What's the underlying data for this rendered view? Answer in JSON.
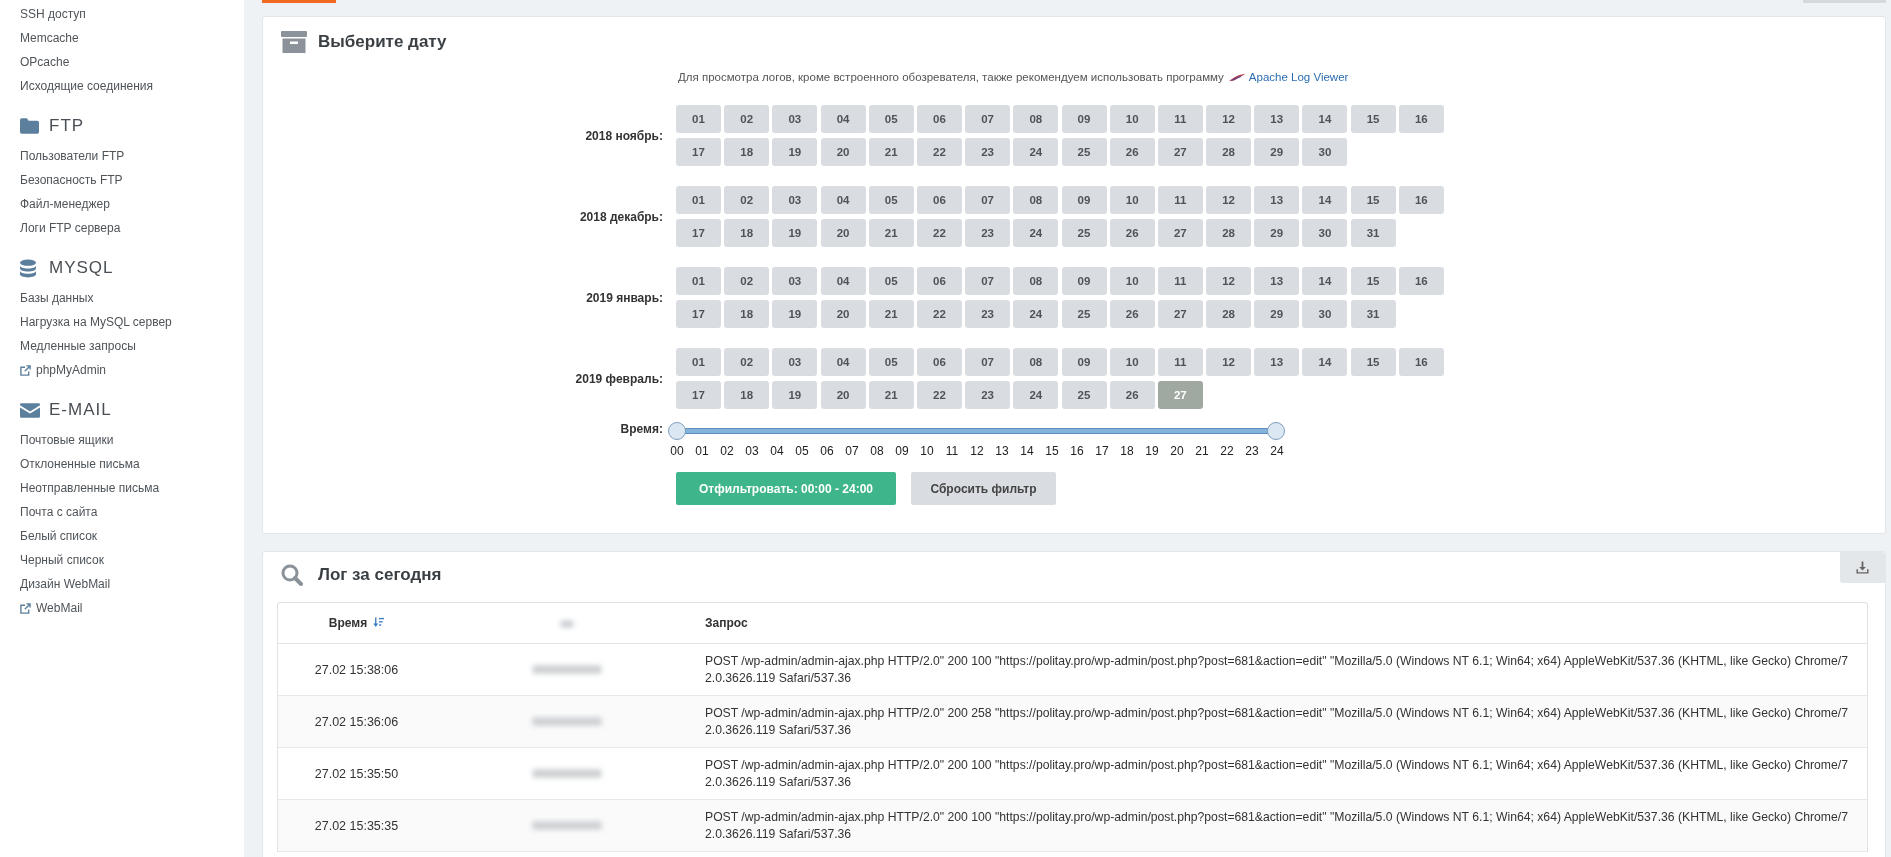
{
  "sidebar": {
    "sections": [
      {
        "items": [
          {
            "label": "SSH доступ",
            "external": false
          },
          {
            "label": "Memcache",
            "external": false
          },
          {
            "label": "OPcache",
            "external": false
          },
          {
            "label": "Исходящие соединения",
            "external": false
          }
        ]
      },
      {
        "title": "FTP",
        "items": [
          {
            "label": "Пользователи FTP",
            "external": false
          },
          {
            "label": "Безопасность FTP",
            "external": false
          },
          {
            "label": "Файл-менеджер",
            "external": false
          },
          {
            "label": "Логи FTP сервера",
            "external": false
          }
        ]
      },
      {
        "title": "MYSQL",
        "items": [
          {
            "label": "Базы данных",
            "external": false
          },
          {
            "label": "Нагрузка на MySQL сервер",
            "external": false
          },
          {
            "label": "Медленные запросы",
            "external": false
          },
          {
            "label": "phpMyAdmin",
            "external": true
          }
        ]
      },
      {
        "title": "E-MAIL",
        "items": [
          {
            "label": "Почтовые ящики",
            "external": false
          },
          {
            "label": "Отклоненные письма",
            "external": false
          },
          {
            "label": "Неотправленные письма",
            "external": false
          },
          {
            "label": "Почта с сайта",
            "external": false
          },
          {
            "label": "Белый список",
            "external": false
          },
          {
            "label": "Черный список",
            "external": false
          },
          {
            "label": "Дизайн WebMail",
            "external": false
          },
          {
            "label": "WebMail",
            "external": true
          }
        ]
      }
    ]
  },
  "date_picker": {
    "title": "Выберите дату",
    "hint": "Для просмотра логов, кроме встроенного обозревателя, также рекомендуем использовать программу",
    "link": "Apache Log Viewer",
    "months": [
      {
        "label": "2018 ноябрь:",
        "days": [
          {
            "label": "01",
            "selected": false
          },
          {
            "label": "02",
            "selected": false
          },
          {
            "label": "03",
            "selected": false
          },
          {
            "label": "04",
            "selected": false
          },
          {
            "label": "05",
            "selected": false
          },
          {
            "label": "06",
            "selected": false
          },
          {
            "label": "07",
            "selected": false
          },
          {
            "label": "08",
            "selected": false
          },
          {
            "label": "09",
            "selected": false
          },
          {
            "label": "10",
            "selected": false
          },
          {
            "label": "11",
            "selected": false
          },
          {
            "label": "12",
            "selected": false
          },
          {
            "label": "13",
            "selected": false
          },
          {
            "label": "14",
            "selected": false
          },
          {
            "label": "15",
            "selected": false
          },
          {
            "label": "16",
            "selected": false
          },
          {
            "label": "17",
            "selected": false
          },
          {
            "label": "18",
            "selected": false
          },
          {
            "label": "19",
            "selected": false
          },
          {
            "label": "20",
            "selected": false
          },
          {
            "label": "21",
            "selected": false
          },
          {
            "label": "22",
            "selected": false
          },
          {
            "label": "23",
            "selected": false
          },
          {
            "label": "24",
            "selected": false
          },
          {
            "label": "25",
            "selected": false
          },
          {
            "label": "26",
            "selected": false
          },
          {
            "label": "27",
            "selected": false
          },
          {
            "label": "28",
            "selected": false
          },
          {
            "label": "29",
            "selected": false
          },
          {
            "label": "30",
            "selected": false
          }
        ]
      },
      {
        "label": "2018 декабрь:",
        "days": [
          {
            "label": "01",
            "selected": false
          },
          {
            "label": "02",
            "selected": false
          },
          {
            "label": "03",
            "selected": false
          },
          {
            "label": "04",
            "selected": false
          },
          {
            "label": "05",
            "selected": false
          },
          {
            "label": "06",
            "selected": false
          },
          {
            "label": "07",
            "selected": false
          },
          {
            "label": "08",
            "selected": false
          },
          {
            "label": "09",
            "selected": false
          },
          {
            "label": "10",
            "selected": false
          },
          {
            "label": "11",
            "selected": false
          },
          {
            "label": "12",
            "selected": false
          },
          {
            "label": "13",
            "selected": false
          },
          {
            "label": "14",
            "selected": false
          },
          {
            "label": "15",
            "selected": false
          },
          {
            "label": "16",
            "selected": false
          },
          {
            "label": "17",
            "selected": false
          },
          {
            "label": "18",
            "selected": false
          },
          {
            "label": "19",
            "selected": false
          },
          {
            "label": "20",
            "selected": false
          },
          {
            "label": "21",
            "selected": false
          },
          {
            "label": "22",
            "selected": false
          },
          {
            "label": "23",
            "selected": false
          },
          {
            "label": "24",
            "selected": false
          },
          {
            "label": "25",
            "selected": false
          },
          {
            "label": "26",
            "selected": false
          },
          {
            "label": "27",
            "selected": false
          },
          {
            "label": "28",
            "selected": false
          },
          {
            "label": "29",
            "selected": false
          },
          {
            "label": "30",
            "selected": false
          },
          {
            "label": "31",
            "selected": false
          }
        ]
      },
      {
        "label": "2019 январь:",
        "days": [
          {
            "label": "01",
            "selected": false
          },
          {
            "label": "02",
            "selected": false
          },
          {
            "label": "03",
            "selected": false
          },
          {
            "label": "04",
            "selected": false
          },
          {
            "label": "05",
            "selected": false
          },
          {
            "label": "06",
            "selected": false
          },
          {
            "label": "07",
            "selected": false
          },
          {
            "label": "08",
            "selected": false
          },
          {
            "label": "09",
            "selected": false
          },
          {
            "label": "10",
            "selected": false
          },
          {
            "label": "11",
            "selected": false
          },
          {
            "label": "12",
            "selected": false
          },
          {
            "label": "13",
            "selected": false
          },
          {
            "label": "14",
            "selected": false
          },
          {
            "label": "15",
            "selected": false
          },
          {
            "label": "16",
            "selected": false
          },
          {
            "label": "17",
            "selected": false
          },
          {
            "label": "18",
            "selected": false
          },
          {
            "label": "19",
            "selected": false
          },
          {
            "label": "20",
            "selected": false
          },
          {
            "label": "21",
            "selected": false
          },
          {
            "label": "22",
            "selected": false
          },
          {
            "label": "23",
            "selected": false
          },
          {
            "label": "24",
            "selected": false
          },
          {
            "label": "25",
            "selected": false
          },
          {
            "label": "26",
            "selected": false
          },
          {
            "label": "27",
            "selected": false
          },
          {
            "label": "28",
            "selected": false
          },
          {
            "label": "29",
            "selected": false
          },
          {
            "label": "30",
            "selected": false
          },
          {
            "label": "31",
            "selected": false
          }
        ]
      },
      {
        "label": "2019 февраль:",
        "days": [
          {
            "label": "01",
            "selected": false
          },
          {
            "label": "02",
            "selected": false
          },
          {
            "label": "03",
            "selected": false
          },
          {
            "label": "04",
            "selected": false
          },
          {
            "label": "05",
            "selected": false
          },
          {
            "label": "06",
            "selected": false
          },
          {
            "label": "07",
            "selected": false
          },
          {
            "label": "08",
            "selected": false
          },
          {
            "label": "09",
            "selected": false
          },
          {
            "label": "10",
            "selected": false
          },
          {
            "label": "11",
            "selected": false
          },
          {
            "label": "12",
            "selected": false
          },
          {
            "label": "13",
            "selected": false
          },
          {
            "label": "14",
            "selected": false
          },
          {
            "label": "15",
            "selected": false
          },
          {
            "label": "16",
            "selected": false
          },
          {
            "label": "17",
            "selected": false
          },
          {
            "label": "18",
            "selected": false
          },
          {
            "label": "19",
            "selected": false
          },
          {
            "label": "20",
            "selected": false
          },
          {
            "label": "21",
            "selected": false
          },
          {
            "label": "22",
            "selected": false
          },
          {
            "label": "23",
            "selected": false
          },
          {
            "label": "24",
            "selected": false
          },
          {
            "label": "25",
            "selected": false
          },
          {
            "label": "26",
            "selected": false
          },
          {
            "label": "27",
            "selected": true
          }
        ]
      }
    ],
    "time": {
      "label": "Время:",
      "handles": [
        {
          "level": 0
        },
        {
          "level": 1
        }
      ],
      "ticks": [
        "00",
        "01",
        "02",
        "03",
        "04",
        "05",
        "06",
        "07",
        "08",
        "09",
        "10",
        "11",
        "12",
        "13",
        "14",
        "15",
        "16",
        "17",
        "18",
        "19",
        "20",
        "21",
        "22",
        "23",
        "24"
      ]
    },
    "buttons": [
      {
        "label": "Отфильтровать: 00:00 - 24:00",
        "kind": "primary"
      },
      {
        "label": "Сбросить фильтр",
        "kind": "secondary"
      }
    ]
  },
  "log": {
    "title": "Лог за сегодня",
    "columns": [
      {
        "kind": "time",
        "label": "Время",
        "sorted": true
      },
      {
        "kind": "blurred",
        "sorted": false
      },
      {
        "kind": "request",
        "label": "Запрос",
        "sorted": false
      }
    ],
    "rows": [
      {
        "time": "27.02 15:38:06",
        "request": "POST /wp-admin/admin-ajax.php HTTP/2.0\" 200 100 \"https://politay.pro/wp-admin/post.php?post=681&action=edit\" \"Mozilla/5.0 (Windows NT 6.1; Win64; x64) AppleWebKit/537.36 (KHTML, like Gecko) Chrome/72.0.3626.119 Safari/537.36"
      },
      {
        "time": "27.02 15:36:06",
        "request": "POST /wp-admin/admin-ajax.php HTTP/2.0\" 200 258 \"https://politay.pro/wp-admin/post.php?post=681&action=edit\" \"Mozilla/5.0 (Windows NT 6.1; Win64; x64) AppleWebKit/537.36 (KHTML, like Gecko) Chrome/72.0.3626.119 Safari/537.36"
      },
      {
        "time": "27.02 15:35:50",
        "request": "POST /wp-admin/admin-ajax.php HTTP/2.0\" 200 100 \"https://politay.pro/wp-admin/post.php?post=681&action=edit\" \"Mozilla/5.0 (Windows NT 6.1; Win64; x64) AppleWebKit/537.36 (KHTML, like Gecko) Chrome/72.0.3626.119 Safari/537.36"
      },
      {
        "time": "27.02 15:35:35",
        "request": "POST /wp-admin/admin-ajax.php HTTP/2.0\" 200 100 \"https://politay.pro/wp-admin/post.php?post=681&action=edit\" \"Mozilla/5.0 (Windows NT 6.1; Win64; x64) AppleWebKit/537.36 (KHTML, like Gecko) Chrome/72.0.3626.119 Safari/537.36"
      }
    ]
  }
}
